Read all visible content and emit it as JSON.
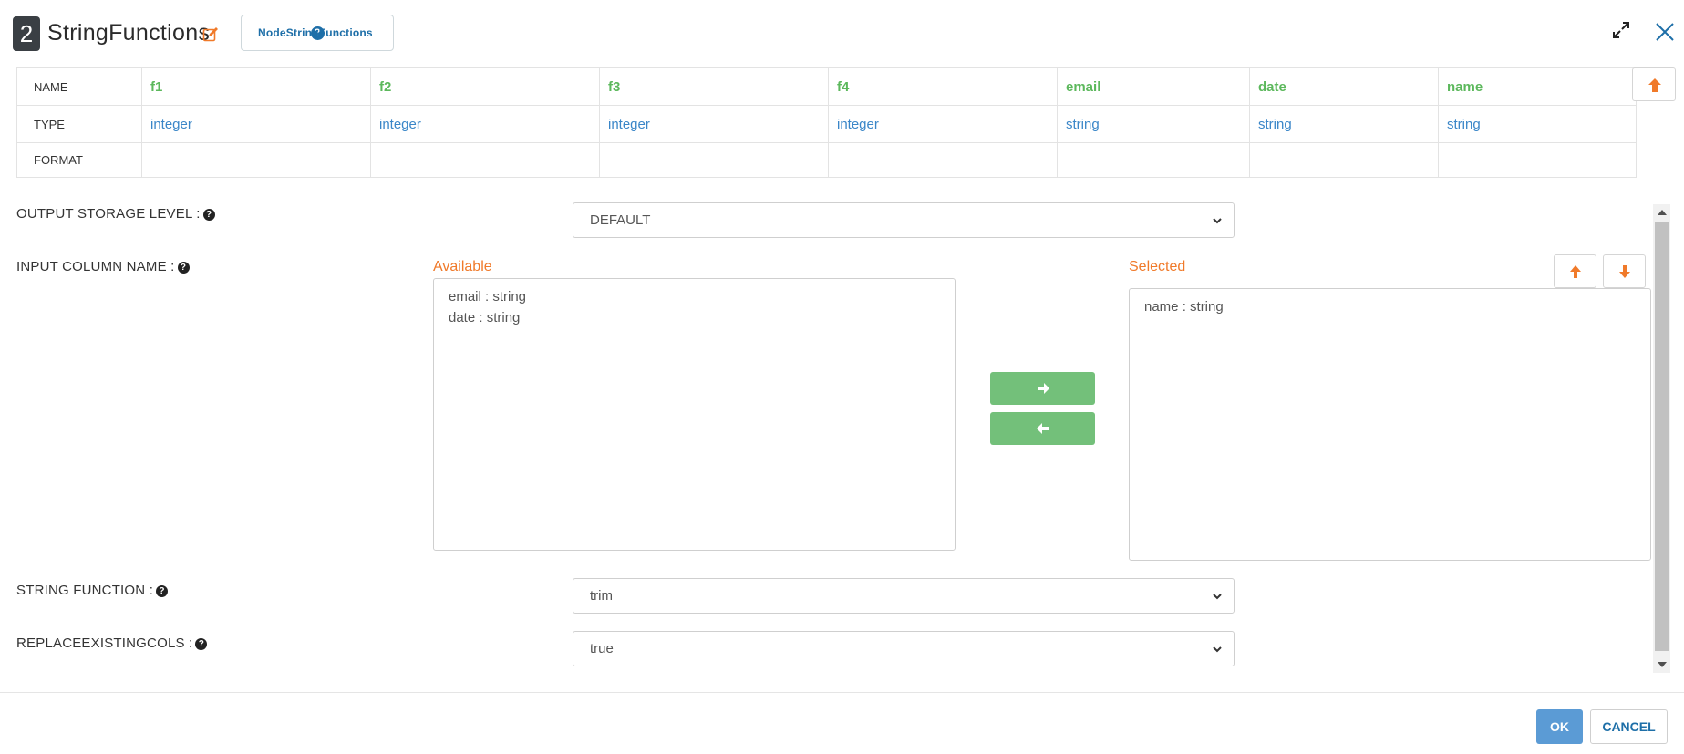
{
  "header": {
    "node_number": "2",
    "node_title": "StringFunctions",
    "help_button_label": "NodeStringFunctions"
  },
  "schema": {
    "row_labels": [
      "NAME",
      "TYPE",
      "FORMAT"
    ],
    "columns": [
      {
        "name": "f1",
        "type": "integer",
        "format": ""
      },
      {
        "name": "f2",
        "type": "integer",
        "format": ""
      },
      {
        "name": "f3",
        "type": "integer",
        "format": ""
      },
      {
        "name": "f4",
        "type": "integer",
        "format": ""
      },
      {
        "name": "email",
        "type": "string",
        "format": ""
      },
      {
        "name": "date",
        "type": "string",
        "format": ""
      },
      {
        "name": "name",
        "type": "string",
        "format": ""
      }
    ]
  },
  "form": {
    "output_storage_level": {
      "label": "OUTPUT STORAGE LEVEL :",
      "value": "DEFAULT"
    },
    "input_column_name": {
      "label": "INPUT COLUMN NAME :",
      "available_label": "Available",
      "selected_label": "Selected",
      "available_items": [
        "email : string",
        "date : string"
      ],
      "selected_items": [
        "name : string"
      ]
    },
    "string_function": {
      "label": "STRING FUNCTION :",
      "value": "trim"
    },
    "replace_existing_cols": {
      "label": "REPLACEEXISTINGCOLS :",
      "value": "true"
    }
  },
  "footer": {
    "ok_label": "OK",
    "cancel_label": "CANCEL"
  },
  "colors": {
    "accent_green": "#73c07a",
    "accent_orange": "#f07a2a",
    "link_blue": "#1e6fa8",
    "ok_blue": "#5b9bd5"
  }
}
